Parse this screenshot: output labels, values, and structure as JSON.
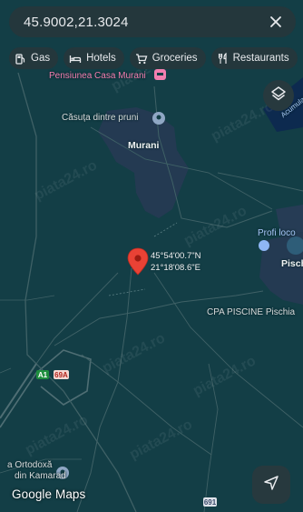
{
  "search": {
    "query": "45.9002,21.3024"
  },
  "chips": [
    {
      "label": "Gas",
      "icon": "gas-station-icon"
    },
    {
      "label": "Hotels",
      "icon": "bed-icon"
    },
    {
      "label": "Groceries",
      "icon": "shopping-cart-icon"
    },
    {
      "label": "Restaurants",
      "icon": "fork-knife-icon"
    }
  ],
  "places": {
    "pension": "Pensiunea Casa Murani",
    "cottage": "Căsuța dintre pruni",
    "village": "Murani",
    "profi": "Profi loco",
    "pischia_short": "Pisch",
    "cpa": "CPA PISCINE Pischia",
    "church_line1": "a Ortodoxă",
    "church_line2": "din Kamarad",
    "accumulation": "Acumularea"
  },
  "pin": {
    "lat": "45°54'00.7\"N",
    "lng": "21°18'08.6\"E"
  },
  "roads": {
    "a1": "A1",
    "r69a": "69A",
    "r691": "691"
  },
  "watermark": "piata24.ro",
  "brand": "Google Maps",
  "colors": {
    "land": "#133e46",
    "settlement": "#243a52",
    "water": "#0d2a4f",
    "road": "#4f6e74",
    "pin": "#e94235"
  }
}
